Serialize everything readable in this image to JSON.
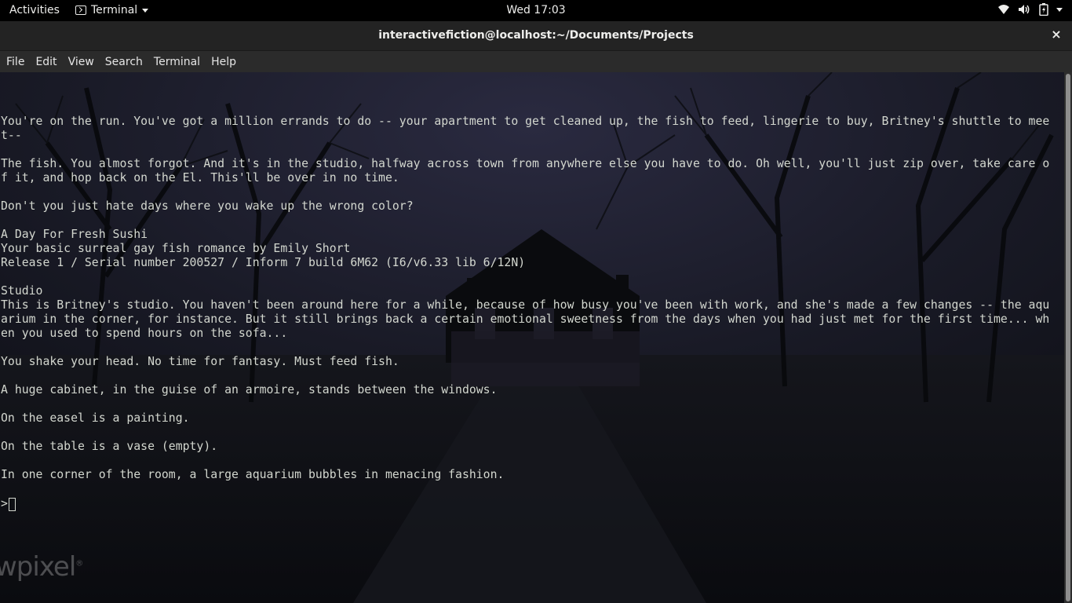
{
  "topbar": {
    "activities_label": "Activities",
    "app_menu_label": "Terminal",
    "clock": "Wed 17:03",
    "icons": [
      "wifi-icon",
      "volume-icon",
      "battery-icon",
      "system-menu-caret-icon"
    ]
  },
  "window": {
    "title": "interactivefiction@localhost:~/Documents/Projects",
    "close_glyph": "×"
  },
  "menubar": {
    "items": [
      "File",
      "Edit",
      "View",
      "Search",
      "Terminal",
      "Help"
    ]
  },
  "terminal": {
    "text": "You're on the run. You've got a million errands to do -- your apartment to get cleaned up, the fish to feed, lingerie to buy, Britney's shuttle to mee\nt--\n\nThe fish. You almost forgot. And it's in the studio, halfway across town from anywhere else you have to do. Oh well, you'll just zip over, take care o\nf it, and hop back on the El. This'll be over in no time.\n\nDon't you just hate days where you wake up the wrong color?\n\nA Day For Fresh Sushi\nYour basic surreal gay fish romance by Emily Short\nRelease 1 / Serial number 200527 / Inform 7 build 6M62 (I6/v6.33 lib 6/12N)\n\nStudio\nThis is Britney's studio. You haven't been around here for a while, because of how busy you've been with work, and she's made a few changes -- the aqu\narium in the corner, for instance. But it still brings back a certain emotional sweetness from the days when you had just met for the first time... wh\nen you used to spend hours on the sofa...\n\nYou shake your head. No time for fantasy. Must feed fish.\n\nA huge cabinet, in the guise of an armoire, stands between the windows.\n\nOn the easel is a painting.\n\nOn the table is a vase (empty).\n\nIn one corner of the room, a large aquarium bubbles in menacing fashion.",
    "prompt": ">",
    "watermark": "wpixel"
  },
  "colors": {
    "terminal_fg": "#d3d7cf",
    "terminal_bg": "#0d0f14",
    "topbar_bg": "#000000",
    "titlebar_bg": "#232323"
  }
}
